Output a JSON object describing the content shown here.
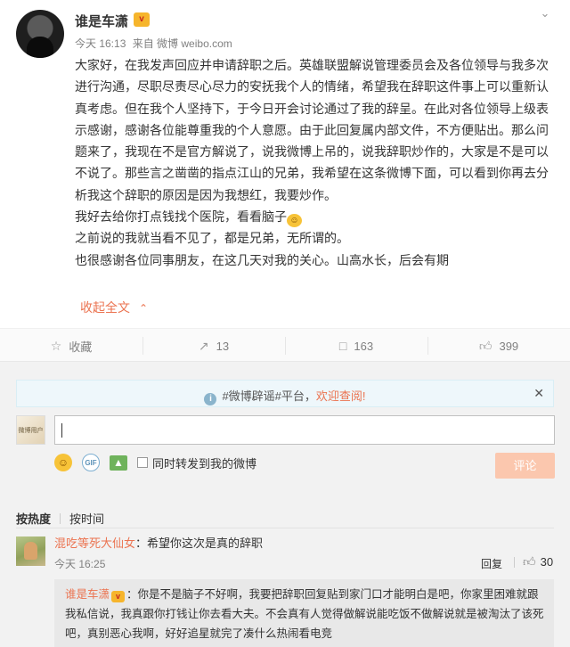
{
  "post": {
    "username": "谁是车潇",
    "vip_badge": "v",
    "meta": {
      "time": "今天 16:13",
      "from": "来自 微博 weibo.com"
    },
    "paragraphs": [
      "大家好，在我发声回应并申请辞职之后。英雄联盟解说管理委员会及各位领导与我多次进行沟通，尽职尽责尽心尽力的安抚我个人的情绪，希望我在辞职这件事上可以重新认真考虑。但在我个人坚持下，于今日开会讨论通过了我的辞呈。在此对各位领导上级表示感谢，感谢各位能尊重我的个人意愿。由于此回复属内部文件，不方便贴出。那么问题来了，我现在不是官方解说了，说我微博上吊的，说我辞职炒作的，大家是不是可以不说了。那些言之凿凿的指点江山的兄弟，我希望在这条微博下面，可以看到你再去分析我这个辞职的原因是因为我想红，我要炒作。",
      "我好去给你打点钱找个医院，看看脑子",
      "之前说的我就当看不见了，都是兄弟，无所谓的。",
      "也很感谢各位同事朋友，在这几天对我的关心。山高水长，后会有期"
    ],
    "collapse_label": "收起全文"
  },
  "actions": {
    "favorite": "收藏",
    "repost": "13",
    "comment": "163",
    "like": "399"
  },
  "notice": {
    "prefix": "#微博辟谣#平台，",
    "link": "欢迎查阅!"
  },
  "composer": {
    "avatar_text": "微博用户",
    "repost_label": "同时转发到我的微博",
    "submit_label": "评论"
  },
  "sort": {
    "hot": "按热度",
    "time": "按时间"
  },
  "comment": {
    "name": "混吃等死大仙女",
    "text": "希望你这次是真的辞职",
    "time": "今天 16:25",
    "reply_label": "回复",
    "likes": "30"
  },
  "reply": {
    "name": "谁是车潇",
    "text": "你是不是脑子不好啊，我要把辞职回复贴到家门口才能明白是吧，你家里困难就跟我私信说，我真跟你打钱让你去看大夫。不会真有人觉得做解说能吃饭不做解说就是被淘汰了该死吧，真别恶心我啊，好好追星就完了凑什么热闹看电竞"
  },
  "colors": {
    "accent": "#eb7350",
    "link_orange": "#eb7350",
    "submit_disabled": "#fbc7ae"
  }
}
